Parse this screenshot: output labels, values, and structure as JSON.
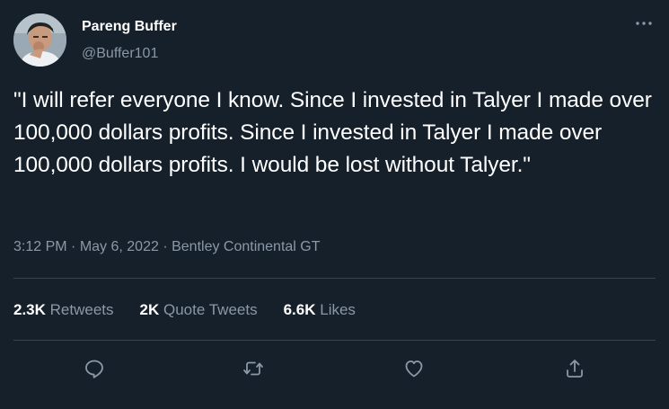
{
  "author": {
    "display_name": "Pareng Buffer",
    "handle": "@Buffer101",
    "avatar_icon": "user-avatar-photo"
  },
  "tweet": {
    "text": "\"I will refer everyone I know. Since I invested in Talyer I made over 100,000 dollars profits. Since I invested in Talyer I made over 100,000 dollars profits. I would be lost without Talyer.\""
  },
  "meta": {
    "time": "3:12 PM",
    "sep1": " · ",
    "date": "May 6, 2022",
    "sep2": " · ",
    "source": "Bentley Continental GT"
  },
  "stats": {
    "retweets_count": "2.3K",
    "retweets_label": "Retweets",
    "quotes_count": "2K",
    "quotes_label": "Quote Tweets",
    "likes_count": "6.6K",
    "likes_label": "Likes"
  },
  "actions": {
    "reply_icon": "reply-icon",
    "retweet_icon": "retweet-icon",
    "like_icon": "like-icon",
    "share_icon": "share-icon",
    "more_icon": "more-options-icon"
  },
  "colors": {
    "background": "#15202b",
    "primary_text": "#ffffff",
    "secondary_text": "#8b98a5",
    "divider": "#38444d"
  }
}
